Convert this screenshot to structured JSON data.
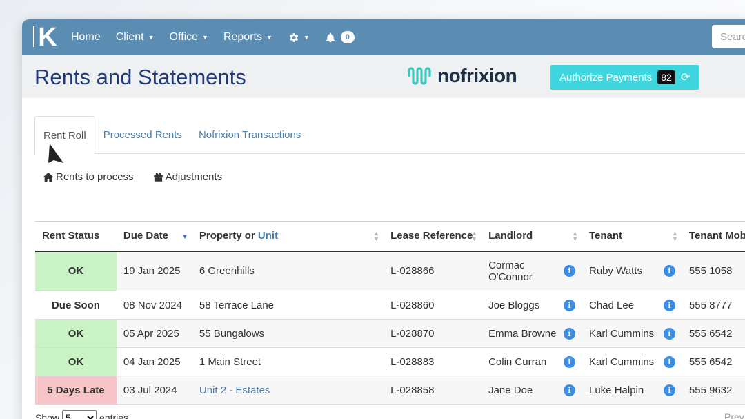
{
  "nav": {
    "logo": "K",
    "items": [
      {
        "label": "Home",
        "caret": false
      },
      {
        "label": "Client",
        "caret": true
      },
      {
        "label": "Office",
        "caret": true
      },
      {
        "label": "Reports",
        "caret": true
      }
    ],
    "notification_count": "0",
    "search_placeholder": "Search"
  },
  "header": {
    "title": "Rents and Statements",
    "brand": "nofrixion",
    "authorize_label": "Authorize Payments",
    "authorize_count": "82"
  },
  "tabs": [
    "Rent Roll",
    "Processed Rents",
    "Nofrixion Transactions"
  ],
  "subnav": [
    "Rents to process",
    "Adjustments"
  ],
  "table": {
    "columns": [
      "Rent Status",
      "Due Date",
      "Property or",
      "Unit",
      "Lease Reference",
      "Landlord",
      "Tenant",
      "Tenant Mob"
    ],
    "rows": [
      {
        "status": "OK",
        "status_type": "ok",
        "due": "19 Jan 2025",
        "property": "6 Greenhills",
        "property_link": false,
        "lease": "L-028866",
        "landlord_line1": "Cormac",
        "landlord_line2": "O'Connor",
        "tenant": "Ruby Watts",
        "mobile": "555 1058"
      },
      {
        "status": "Due Soon",
        "status_type": "due",
        "due": "08 Nov 2024",
        "property": "58 Terrace Lane",
        "property_link": false,
        "lease": "L-028860",
        "landlord_line1": "Joe Bloggs",
        "landlord_line2": "",
        "tenant": "Chad Lee",
        "mobile": "555 8777"
      },
      {
        "status": "OK",
        "status_type": "ok",
        "due": "05 Apr 2025",
        "property": "55 Bungalows",
        "property_link": false,
        "lease": "L-028870",
        "landlord_line1": "Emma Browne",
        "landlord_line2": "",
        "tenant": "Karl Cummins",
        "mobile": "555 6542"
      },
      {
        "status": "OK",
        "status_type": "ok",
        "due": "04 Jan 2025",
        "property": "1 Main Street",
        "property_link": false,
        "lease": "L-028883",
        "landlord_line1": "Colin Curran",
        "landlord_line2": "",
        "tenant": "Karl Cummins",
        "mobile": "555 6542"
      },
      {
        "status": "5 Days Late",
        "status_type": "late",
        "due": "03 Jul 2024",
        "property": "Unit 2 - Estates",
        "property_link": true,
        "lease": "L-028858",
        "landlord_line1": "Jane Doe",
        "landlord_line2": "",
        "tenant": "Luke Halpin",
        "mobile": "555 9632"
      }
    ]
  },
  "footer": {
    "show": "Show",
    "entries_value": "5",
    "entries": "entries",
    "prev": "Prev"
  },
  "colors": {
    "navbar": "#5b8db3",
    "title": "#1e3a78",
    "authorize": "#3fd6e0",
    "ok": "#c9f3c4",
    "late": "#f7c5c8"
  },
  "icons": [
    "gear-icon",
    "bell-icon",
    "refresh-icon",
    "home-icon",
    "gift-icon",
    "info-icon",
    "cursor-pointer-icon"
  ]
}
